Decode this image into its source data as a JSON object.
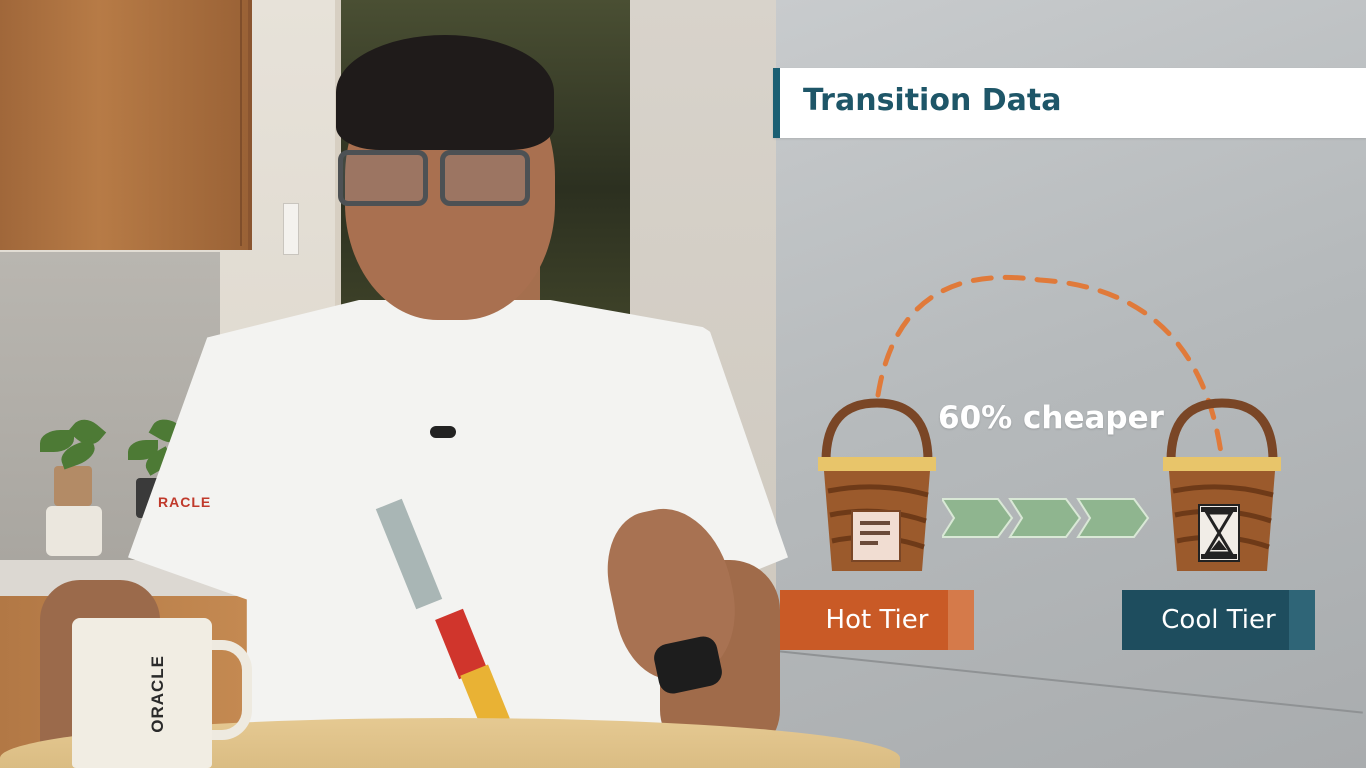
{
  "overlay": {
    "title": "Transition Data",
    "savings_label": "60% cheaper",
    "hot_tier_label": "Hot Tier",
    "cool_tier_label": "Cool Tier",
    "colors": {
      "title_accent": "#1b5f73",
      "hot_tier": "#c95a26",
      "cool_tier": "#1e4d5e",
      "arc_dash": "#e07a3a",
      "chevron": "#8fb58f"
    },
    "icons": [
      "document-icon",
      "hourglass-icon",
      "bucket-icon",
      "chevron-arrow-icon"
    ]
  },
  "scene": {
    "shirt_logo": "RACLE",
    "mug_logo": "ORACLE"
  }
}
